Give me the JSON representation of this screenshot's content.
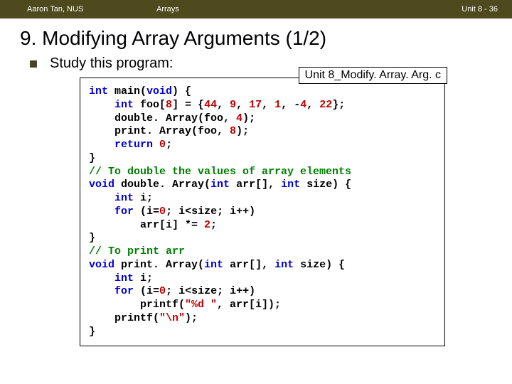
{
  "header": {
    "author": "Aaron Tan, NUS",
    "chapter": "Arrays",
    "pageno": "Unit 8 - 36"
  },
  "title": "9. Modifying Array Arguments (1/2)",
  "bullet_text": "Study this program:",
  "file_label": "Unit 8_Modify. Array. Arg. c",
  "code": {
    "l01a": "int",
    "l01b": " main(",
    "l01c": "void",
    "l01d": ") {",
    "l02a": "    ",
    "l02b": "int",
    "l02c": " foo[",
    "l02d": "8",
    "l02e": "] = {",
    "l02f": "44",
    "l02g": ", ",
    "l02h": "9",
    "l02i": ", ",
    "l02j": "17",
    "l02k": ", ",
    "l02l": "1",
    "l02m": ", -",
    "l02n": "4",
    "l02o": ", ",
    "l02p": "22",
    "l02q": "};",
    "l03a": "    double. Array(foo, ",
    "l03b": "4",
    "l03c": ");",
    "l04a": "    print. Array(foo, ",
    "l04b": "8",
    "l04c": ");",
    "l05a": "    ",
    "l05b": "return",
    "l05c": " ",
    "l05d": "0",
    "l05e": ";",
    "l06": "}",
    "l07": "// To double the values of array elements",
    "l08a": "void",
    "l08b": " double. Array(",
    "l08c": "int",
    "l08d": " arr[], ",
    "l08e": "int",
    "l08f": " size) {",
    "l09a": "    ",
    "l09b": "int",
    "l09c": " i;",
    "l10a": "    ",
    "l10b": "for",
    "l10c": " (i=",
    "l10d": "0",
    "l10e": "; i<size; i++)",
    "l11a": "        arr[i] *= ",
    "l11b": "2",
    "l11c": ";",
    "l12": "}",
    "l13": "// To print arr",
    "l14a": "void",
    "l14b": " print. Array(",
    "l14c": "int",
    "l14d": " arr[], ",
    "l14e": "int",
    "l14f": " size) {",
    "l15a": "    ",
    "l15b": "int",
    "l15c": " i;",
    "l16a": "    ",
    "l16b": "for",
    "l16c": " (i=",
    "l16d": "0",
    "l16e": "; i<size; i++)",
    "l17a": "        printf(",
    "l17b": "\"%d \"",
    "l17c": ", arr[i]);",
    "l18a": "    printf(",
    "l18b": "\"\\n\"",
    "l18c": ");",
    "l19": "}"
  }
}
